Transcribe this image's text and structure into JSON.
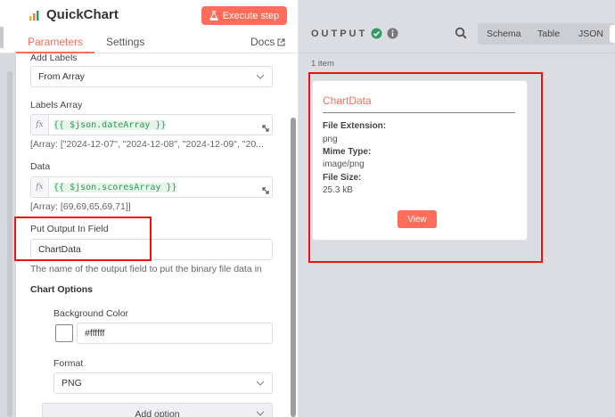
{
  "node": {
    "title": "QuickChart",
    "execute_label": "Execute step",
    "tabs": {
      "parameters": "Parameters",
      "settings": "Settings",
      "docs": "Docs"
    }
  },
  "params": {
    "add_labels": {
      "label": "Add Labels",
      "value": "From Array"
    },
    "labels_array": {
      "label": "Labels Array",
      "expression": "{{ $json.dateArray }}",
      "preview": "[Array: [\"2024-12-07\", \"2024-12-08\", \"2024-12-09\", \"20..."
    },
    "data": {
      "label": "Data",
      "expression": "{{ $json.scoresArray }}",
      "preview": "[Array: [69,69,65,69,71]]"
    },
    "put_output": {
      "label": "Put Output In Field",
      "value": "ChartData",
      "hint": "The name of the output field to put the binary file data in"
    },
    "chart_options": {
      "title": "Chart Options",
      "background_color": {
        "label": "Background Color",
        "value": "#ffffff"
      },
      "format": {
        "label": "Format",
        "value": "PNG"
      },
      "add_option": "Add option"
    }
  },
  "output": {
    "title": "OUTPUT",
    "views": [
      "Schema",
      "Table",
      "JSON"
    ],
    "item_count": "1 item",
    "card": {
      "title": "ChartData",
      "fields": [
        {
          "key": "File Extension:",
          "value": "png"
        },
        {
          "key": "Mime Type:",
          "value": "image/png"
        },
        {
          "key": "File Size:",
          "value": "25.3 kB"
        }
      ],
      "view_label": "View"
    }
  },
  "colors": {
    "accent": "#ff6d5a",
    "success": "#2e9e5f",
    "highlight_box": "#ee1111"
  }
}
